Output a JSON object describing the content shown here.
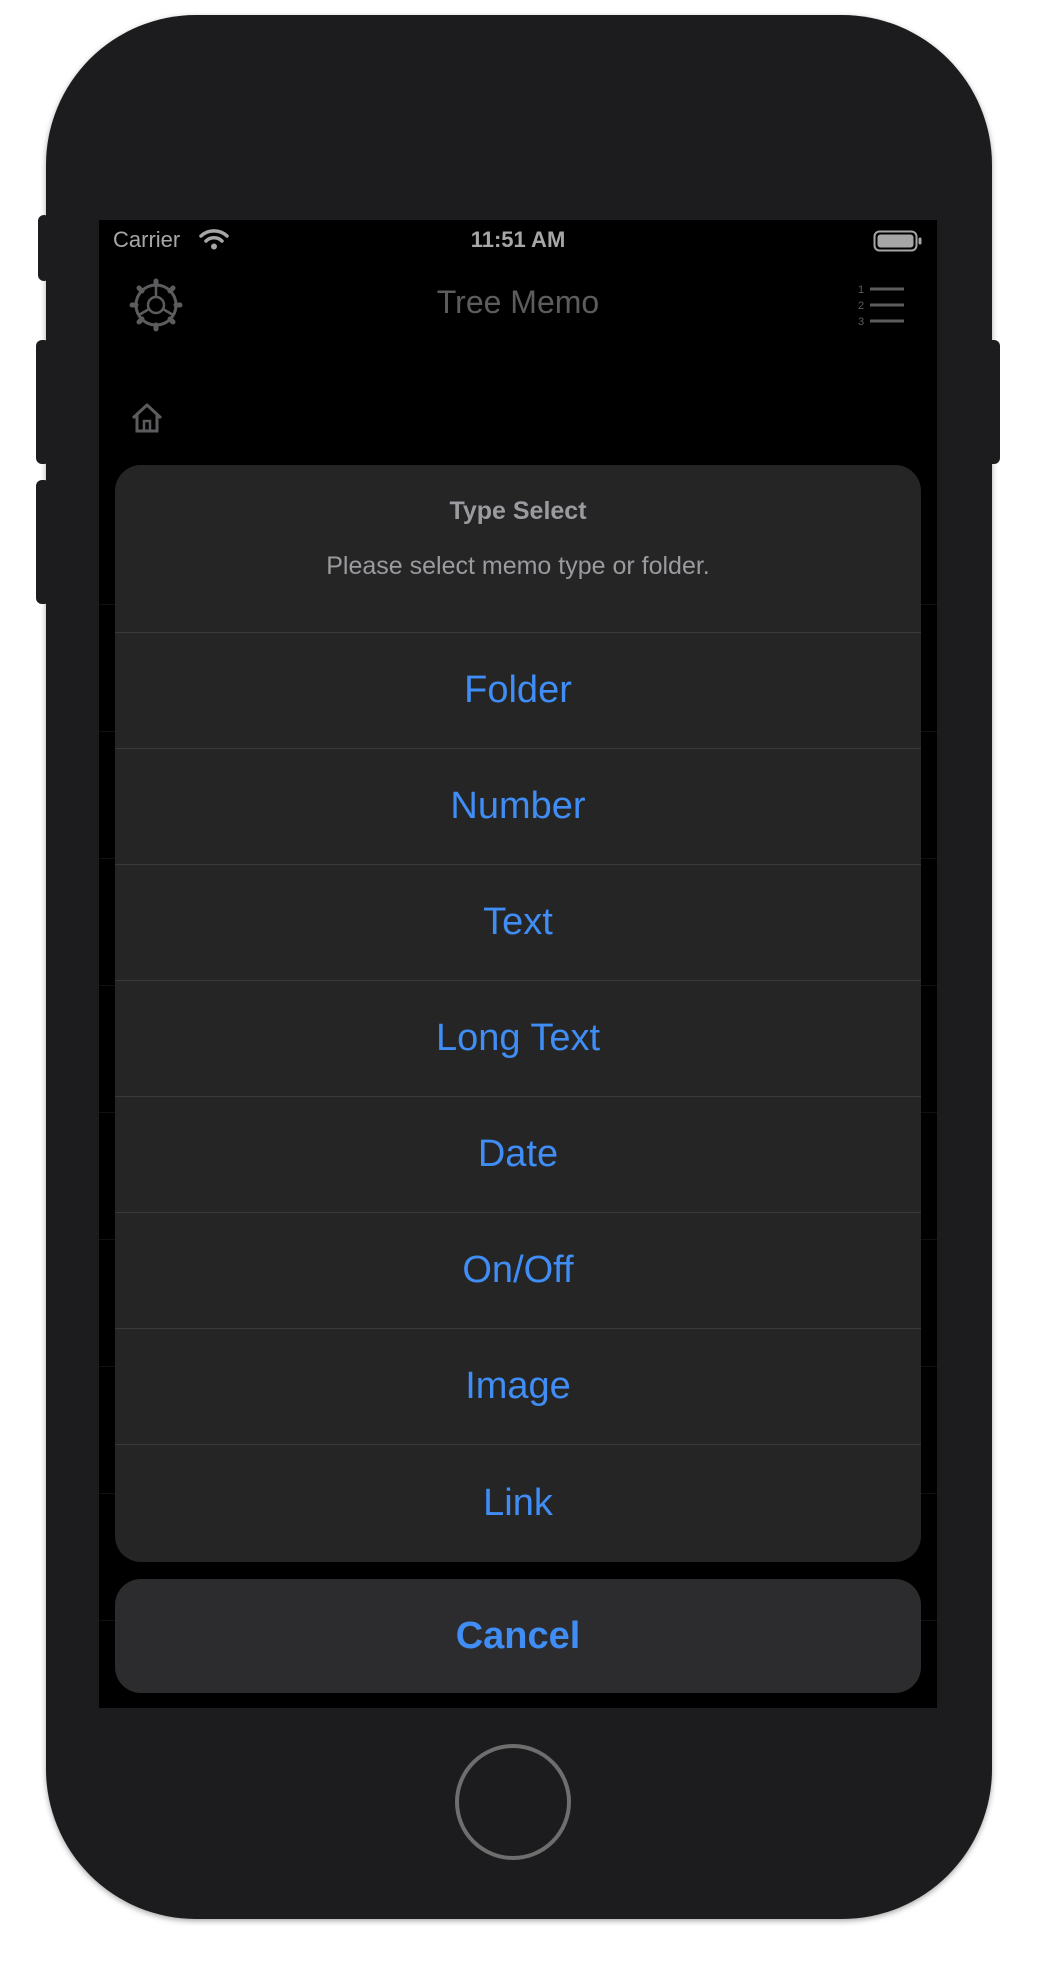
{
  "status_bar": {
    "carrier": "Carrier",
    "time": "11:51 AM"
  },
  "nav": {
    "title": "Tree Memo",
    "left_icon": "gear-icon",
    "right_icon": "numbered-list-icon"
  },
  "breadcrumb": {
    "icon": "home-icon"
  },
  "action_sheet": {
    "title": "Type Select",
    "message": "Please select memo type or folder.",
    "actions": [
      "Folder",
      "Number",
      "Text",
      "Long Text",
      "Date",
      "On/Off",
      "Image",
      "Link"
    ],
    "cancel": "Cancel"
  },
  "colors": {
    "accent": "#3f8df5",
    "sheet": "#252525",
    "cancel_bg": "#2c2c2e",
    "text_muted": "#9a9a9f"
  }
}
